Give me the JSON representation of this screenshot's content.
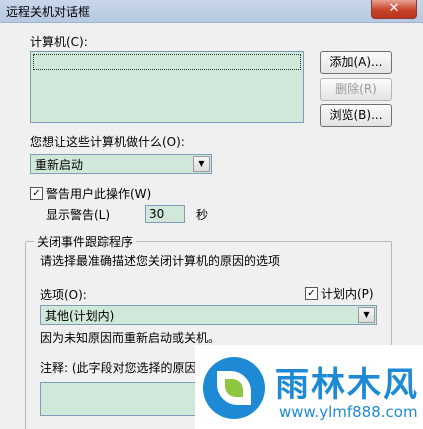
{
  "window": {
    "title": "远程关机对话框",
    "close_glyph": "✕"
  },
  "computers": {
    "label": "计算机(C):",
    "items": [
      ""
    ]
  },
  "buttons": {
    "add": "添加(A)...",
    "remove": "删除(R)",
    "browse": "浏览(B)..."
  },
  "action": {
    "label": "您想让这些计算机做什么(O):",
    "selected": "重新启动"
  },
  "warn": {
    "checkbox_label": "警告用户此操作(W)",
    "checked": true,
    "display_label": "显示警告(L)",
    "seconds": "30",
    "unit": "秒"
  },
  "tracker": {
    "legend": "关闭事件跟踪程序",
    "instruction": "请选择最准确描述您关闭计算机的原因的选项",
    "option_label": "选项(O):",
    "planned_label": "计划内(P)",
    "planned_checked": true,
    "option_selected": "其他(计划内)",
    "description": "因为未知原因而重新启动或关机。",
    "comment_label": "注释: (此字段对您选择的原因"
  },
  "watermark": {
    "name": "雨林木风",
    "url": "www.ylmf888.com"
  },
  "colors": {
    "field_bg": "#cfe8da",
    "watermark_blue": "#1e8ad6",
    "close_red": "#c7432a"
  }
}
